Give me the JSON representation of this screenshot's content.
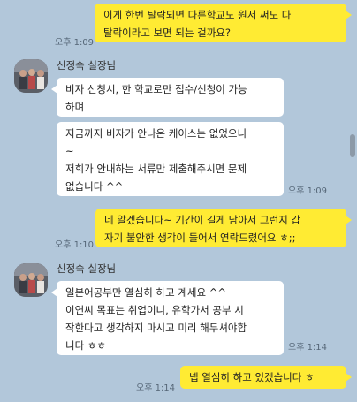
{
  "messages": {
    "m1": {
      "text": "이게 한번 탈락되면 다른학교도 원서 써도 다\n탈락이라고 보면 되는 걸까요?",
      "time": "오후 1:09"
    },
    "sender1": {
      "name": "신정숙 실장님"
    },
    "m2": {
      "text": "비자 신청시, 한 학교로만 접수/신청이 가능\n하며"
    },
    "m3": {
      "text": "지금까지 비자가 안나온 케이스는 없었으니\n~\n저희가 안내하는 서류만 제출해주시면 문제\n없습니다 ^^",
      "time": "오후 1:09"
    },
    "m4": {
      "text": "네 알겠습니다~ 기간이 길게 남아서 그런지 갑\n자기 불안한 생각이 들어서 연락드렸어요 ㅎ;;",
      "time": "오후 1:10"
    },
    "sender2": {
      "name": "신정숙 실장님"
    },
    "m5": {
      "text": "일본어공부만 열심히 하고 계세요 ^^\n이연씨 목표는 취업이니, 유학가서 공부 시\n작한다고 생각하지 마시고 미리 해두셔야합\n니다 ㅎㅎ",
      "time": "오후 1:14"
    },
    "m6": {
      "text": "넵 열심히 하고 있겠습니다 ㅎ",
      "time": "오후 1:14"
    }
  },
  "colors": {
    "background": "#b2c7da",
    "outgoing": "#ffeb33",
    "incoming": "#ffffff"
  },
  "icons": {
    "avatar": "profile-photo"
  }
}
